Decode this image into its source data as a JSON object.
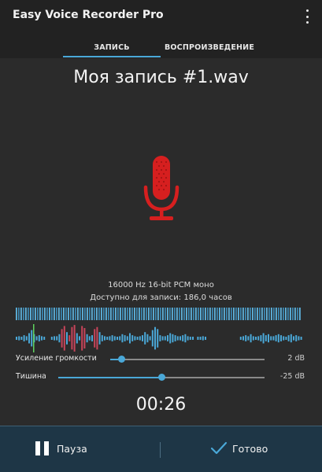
{
  "app": {
    "title": "Easy Voice Recorder Pro"
  },
  "tabs": {
    "record": "ЗАПИСЬ",
    "playback": "ВОСПРОИЗВЕДЕНИЕ",
    "active": "record"
  },
  "recording": {
    "file_name": "Моя запись #1.wav",
    "format": "16000 Hz 16-bit PCM моно",
    "available": "Доступно для записи: 186,0 часов",
    "timer": "00:26"
  },
  "sliders": {
    "gain": {
      "label": "Усиление громкости",
      "value": "2 dB",
      "fraction": 0.05
    },
    "silence": {
      "label": "Тишина",
      "value": "-25 dB",
      "fraction": 0.5
    }
  },
  "buttons": {
    "pause": "Пауза",
    "done": "Готово"
  },
  "icons": {
    "menu": "overflow-menu-icon",
    "microphone": "microphone-icon",
    "pause": "pause-icon",
    "done": "check-icon"
  },
  "colors": {
    "accent": "#4aa8d8",
    "microphone": "#d61f1f",
    "bottom_bar": "#1e3646",
    "background": "#2b2b2b"
  }
}
